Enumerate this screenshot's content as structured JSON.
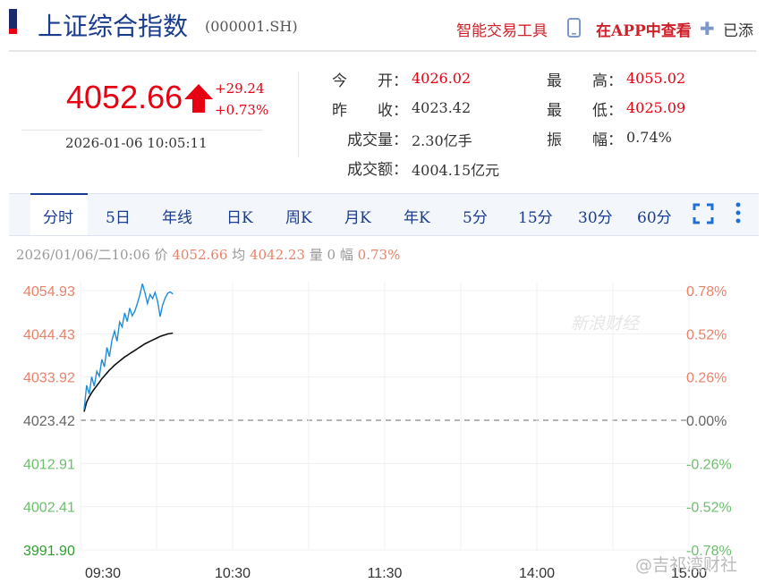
{
  "header": {
    "title": "上证综合指数",
    "code": "(000001.SH)",
    "smart_trade": "智能交易工具",
    "app_view": "在APP中查看",
    "added": "已添"
  },
  "quote": {
    "price": "4052.66",
    "change_abs": "+29.24",
    "change_pct": "+0.73%",
    "time": "2026-01-06 10:05:11"
  },
  "stats": {
    "open": {
      "label": "今　　开：",
      "value": "4026.02"
    },
    "high": {
      "label": "最　　高：",
      "value": "4055.02"
    },
    "prev_close": {
      "label": "昨　　收：",
      "value": "4023.42"
    },
    "low": {
      "label": "最　　低：",
      "value": "4025.09"
    },
    "volume": {
      "label": "成交量：",
      "value": "2.30亿手"
    },
    "amplitude": {
      "label": "振　　幅：",
      "value": "0.74%"
    },
    "turnover": {
      "label": "成交额：",
      "value": "4004.15亿元"
    }
  },
  "tabs": [
    "分时",
    "5日",
    "年线",
    "日K",
    "周K",
    "月K",
    "年K",
    "5分",
    "15分",
    "30分",
    "60分"
  ],
  "active_tab": "分时",
  "info_line": {
    "datetime": "2026/01/06/二10:06",
    "price_label": "价",
    "price": "4052.66",
    "avg_label": "均",
    "avg": "4042.23",
    "vol_label": "量",
    "vol": "0",
    "amp_label": "幅",
    "amp": "0.73%"
  },
  "colors": {
    "up": "#e60012",
    "down": "#4caf50",
    "price_line": "#1f8dd6",
    "avg_line": "#111111",
    "brand": "#1a3c8e"
  },
  "watermark": "新浪财经",
  "weibo_watermark": "@吉祁湾财社",
  "chart_data": {
    "type": "line",
    "x_ticks": [
      "09:30",
      "10:30",
      "11:30",
      "14:00",
      "15:00"
    ],
    "y_left_ticks": [
      "4054.93",
      "4044.43",
      "4033.92",
      "4023.42",
      "4012.91",
      "4002.41",
      "3991.90"
    ],
    "y_right_ticks": [
      "0.78%",
      "0.52%",
      "0.26%",
      "0.00%",
      "-0.26%",
      "-0.52%",
      "-0.78%"
    ],
    "ylim": [
      3991.9,
      4054.93
    ],
    "reference": 4023.42,
    "x_session_minutes": 240,
    "series": [
      {
        "key": "price",
        "x": [
          0,
          1,
          2,
          3,
          4,
          5,
          6,
          7,
          8,
          9,
          10,
          11,
          12,
          13,
          14,
          15,
          16,
          17,
          18,
          19,
          20,
          21,
          22,
          23,
          24,
          25,
          26,
          27,
          28,
          29,
          30,
          31,
          32,
          33,
          34,
          35
        ],
        "values": [
          4026.0,
          4031.9,
          4029.8,
          4034.0,
          4031.7,
          4035.3,
          4034.1,
          4038.2,
          4036.4,
          4041.1,
          4038.9,
          4043.0,
          4045.1,
          4042.6,
          4047.3,
          4046.1,
          4049.5,
          4047.4,
          4050.7,
          4048.8,
          4049.9,
          4051.8,
          4053.9,
          4056.6,
          4054.4,
          4051.8,
          4054.0,
          4053.0,
          4054.5,
          4052.3,
          4048.6,
          4051.5,
          4053.2,
          4054.3,
          4054.6,
          4054.1
        ]
      },
      {
        "key": "avg",
        "x": [
          0,
          1,
          2,
          3,
          4,
          5,
          6,
          7,
          8,
          9,
          10,
          11,
          12,
          13,
          14,
          15,
          16,
          17,
          18,
          19,
          20,
          21,
          22,
          23,
          24,
          25,
          26,
          27,
          28,
          29,
          30,
          31,
          32,
          33,
          34,
          35
        ],
        "values": [
          4025.5,
          4027.8,
          4029.1,
          4030.1,
          4031.0,
          4031.8,
          4032.6,
          4033.5,
          4034.2,
          4034.9,
          4035.6,
          4036.2,
          4036.8,
          4037.3,
          4037.8,
          4038.3,
          4038.8,
          4039.2,
          4039.6,
          4040.0,
          4040.4,
          4040.8,
          4041.2,
          4041.6,
          4042.0,
          4042.3,
          4042.6,
          4042.9,
          4043.2,
          4043.5,
          4043.8,
          4044.0,
          4044.2,
          4044.4,
          4044.5,
          4044.6
        ]
      }
    ]
  }
}
